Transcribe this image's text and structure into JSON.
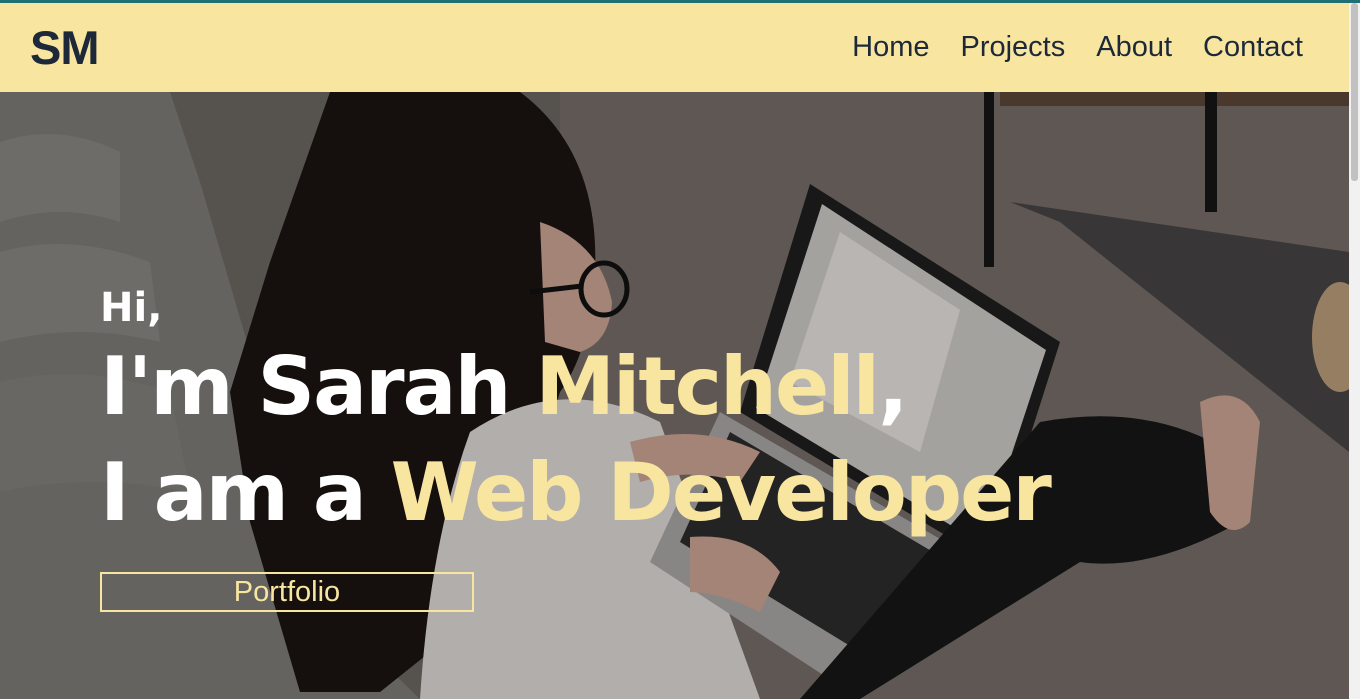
{
  "nav": {
    "logo": "SM",
    "links": [
      "Home",
      "Projects",
      "About",
      "Contact"
    ]
  },
  "hero": {
    "greeting": "Hi,",
    "line1_prefix": "I'm Sarah ",
    "line1_accent": "Mitchell",
    "line1_suffix": ",",
    "line2_prefix": "I am a ",
    "line2_accent": "Web Developer",
    "button_label": "Portfolio"
  },
  "colors": {
    "accent": "#f8e5a0",
    "navbar_bg": "#f8e5a0",
    "text_dark": "#1d2939",
    "top_strip": "#1f6f73"
  },
  "scrollbar": {
    "position_fraction": 0.0
  }
}
